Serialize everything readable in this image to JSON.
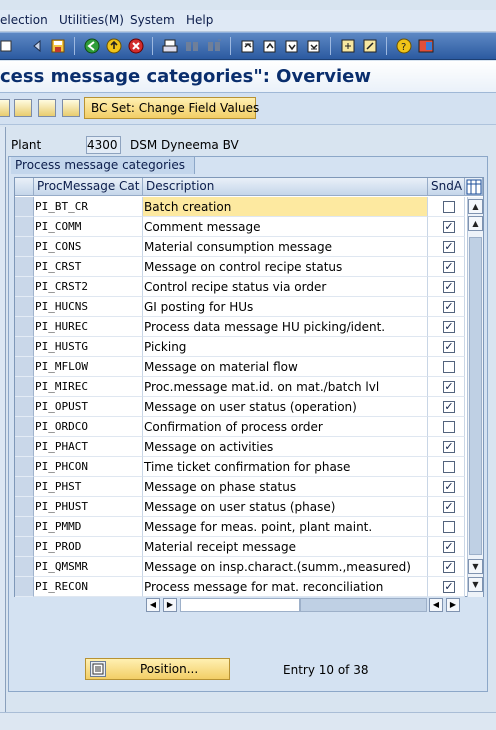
{
  "menu": [
    "election",
    "Utilities(M)",
    "System",
    "Help"
  ],
  "title": "cess message categories\": Overview",
  "app_toolbar": {
    "bcset_label": "BC Set: Change Field Values"
  },
  "plant": {
    "label": "Plant",
    "value": "4300",
    "name": "DSM Dyneema BV"
  },
  "group_title": "Process message categories",
  "table": {
    "headers": {
      "cat": "ProcMessage Cat",
      "desc": "Description",
      "snd": "SndA"
    },
    "rows": [
      {
        "cat": "PI_BT_CR",
        "desc": "Batch creation",
        "snd": false,
        "highlight": true
      },
      {
        "cat": "PI_COMM",
        "desc": "Comment message",
        "snd": true
      },
      {
        "cat": "PI_CONS",
        "desc": "Material consumption message",
        "snd": true
      },
      {
        "cat": "PI_CRST",
        "desc": "Message on control recipe status",
        "snd": true
      },
      {
        "cat": "PI_CRST2",
        "desc": "Control recipe status via order",
        "snd": true
      },
      {
        "cat": "PI_HUCNS",
        "desc": "GI posting for HUs",
        "snd": true
      },
      {
        "cat": "PI_HUREC",
        "desc": "Process data message HU picking/ident.",
        "snd": true
      },
      {
        "cat": "PI_HUSTG",
        "desc": "Picking",
        "snd": true
      },
      {
        "cat": "PI_MFLOW",
        "desc": "Message on material flow",
        "snd": false
      },
      {
        "cat": "PI_MIREC",
        "desc": "Proc.message mat.id. on mat./batch lvl",
        "snd": true
      },
      {
        "cat": "PI_OPUST",
        "desc": "Message on user status (operation)",
        "snd": true
      },
      {
        "cat": "PI_ORDCO",
        "desc": "Confirmation of process order",
        "snd": false
      },
      {
        "cat": "PI_PHACT",
        "desc": "Message on activities",
        "snd": true
      },
      {
        "cat": "PI_PHCON",
        "desc": "Time ticket confirmation for phase",
        "snd": false
      },
      {
        "cat": "PI_PHST",
        "desc": "Message on phase status",
        "snd": true
      },
      {
        "cat": "PI_PHUST",
        "desc": "Message on user status (phase)",
        "snd": true
      },
      {
        "cat": "PI_PMMD",
        "desc": "Message for meas. point, plant maint.",
        "snd": false
      },
      {
        "cat": "PI_PROD",
        "desc": "Material receipt message",
        "snd": true
      },
      {
        "cat": "PI_QMSMR",
        "desc": "Message on insp.charact.(summ.,measured)",
        "snd": true
      },
      {
        "cat": "PI_RECON",
        "desc": "Process message for mat. reconciliation",
        "snd": true
      }
    ]
  },
  "position_button": "Position...",
  "entry_text": "Entry 10 of 38",
  "colors": {
    "highlight": "#fde9a0",
    "accent": "#2b5aa0",
    "title": "#0a2e6d"
  }
}
